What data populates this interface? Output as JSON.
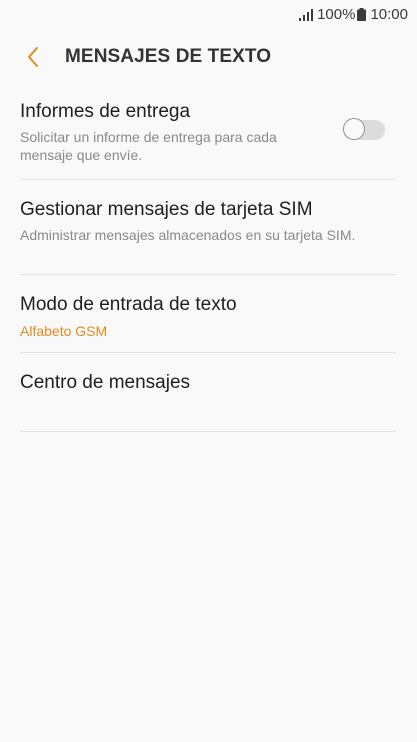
{
  "status_bar": {
    "battery_percent": "100%",
    "time": "10:00",
    "icons": [
      "signal-icon",
      "battery-icon"
    ]
  },
  "header": {
    "back_icon": "chevron-left-icon",
    "title": "MENSAJES DE TEXTO"
  },
  "settings": {
    "delivery_reports": {
      "title": "Informes de entrega",
      "description": "Solicitar un informe de entrega para cada mensaje que envíe.",
      "toggle_on": false
    },
    "sim_messages": {
      "title": "Gestionar mensajes de tarjeta SIM",
      "description": "Administrar mensajes almacenados en su tarjeta SIM."
    },
    "input_mode": {
      "title": "Modo de entrada de texto",
      "value": "Alfabeto GSM"
    },
    "message_center": {
      "title": "Centro de mensajes"
    }
  },
  "colors": {
    "accent": "#e38a20",
    "background": "#f9f9f9",
    "divider": "#e3e3e3"
  }
}
